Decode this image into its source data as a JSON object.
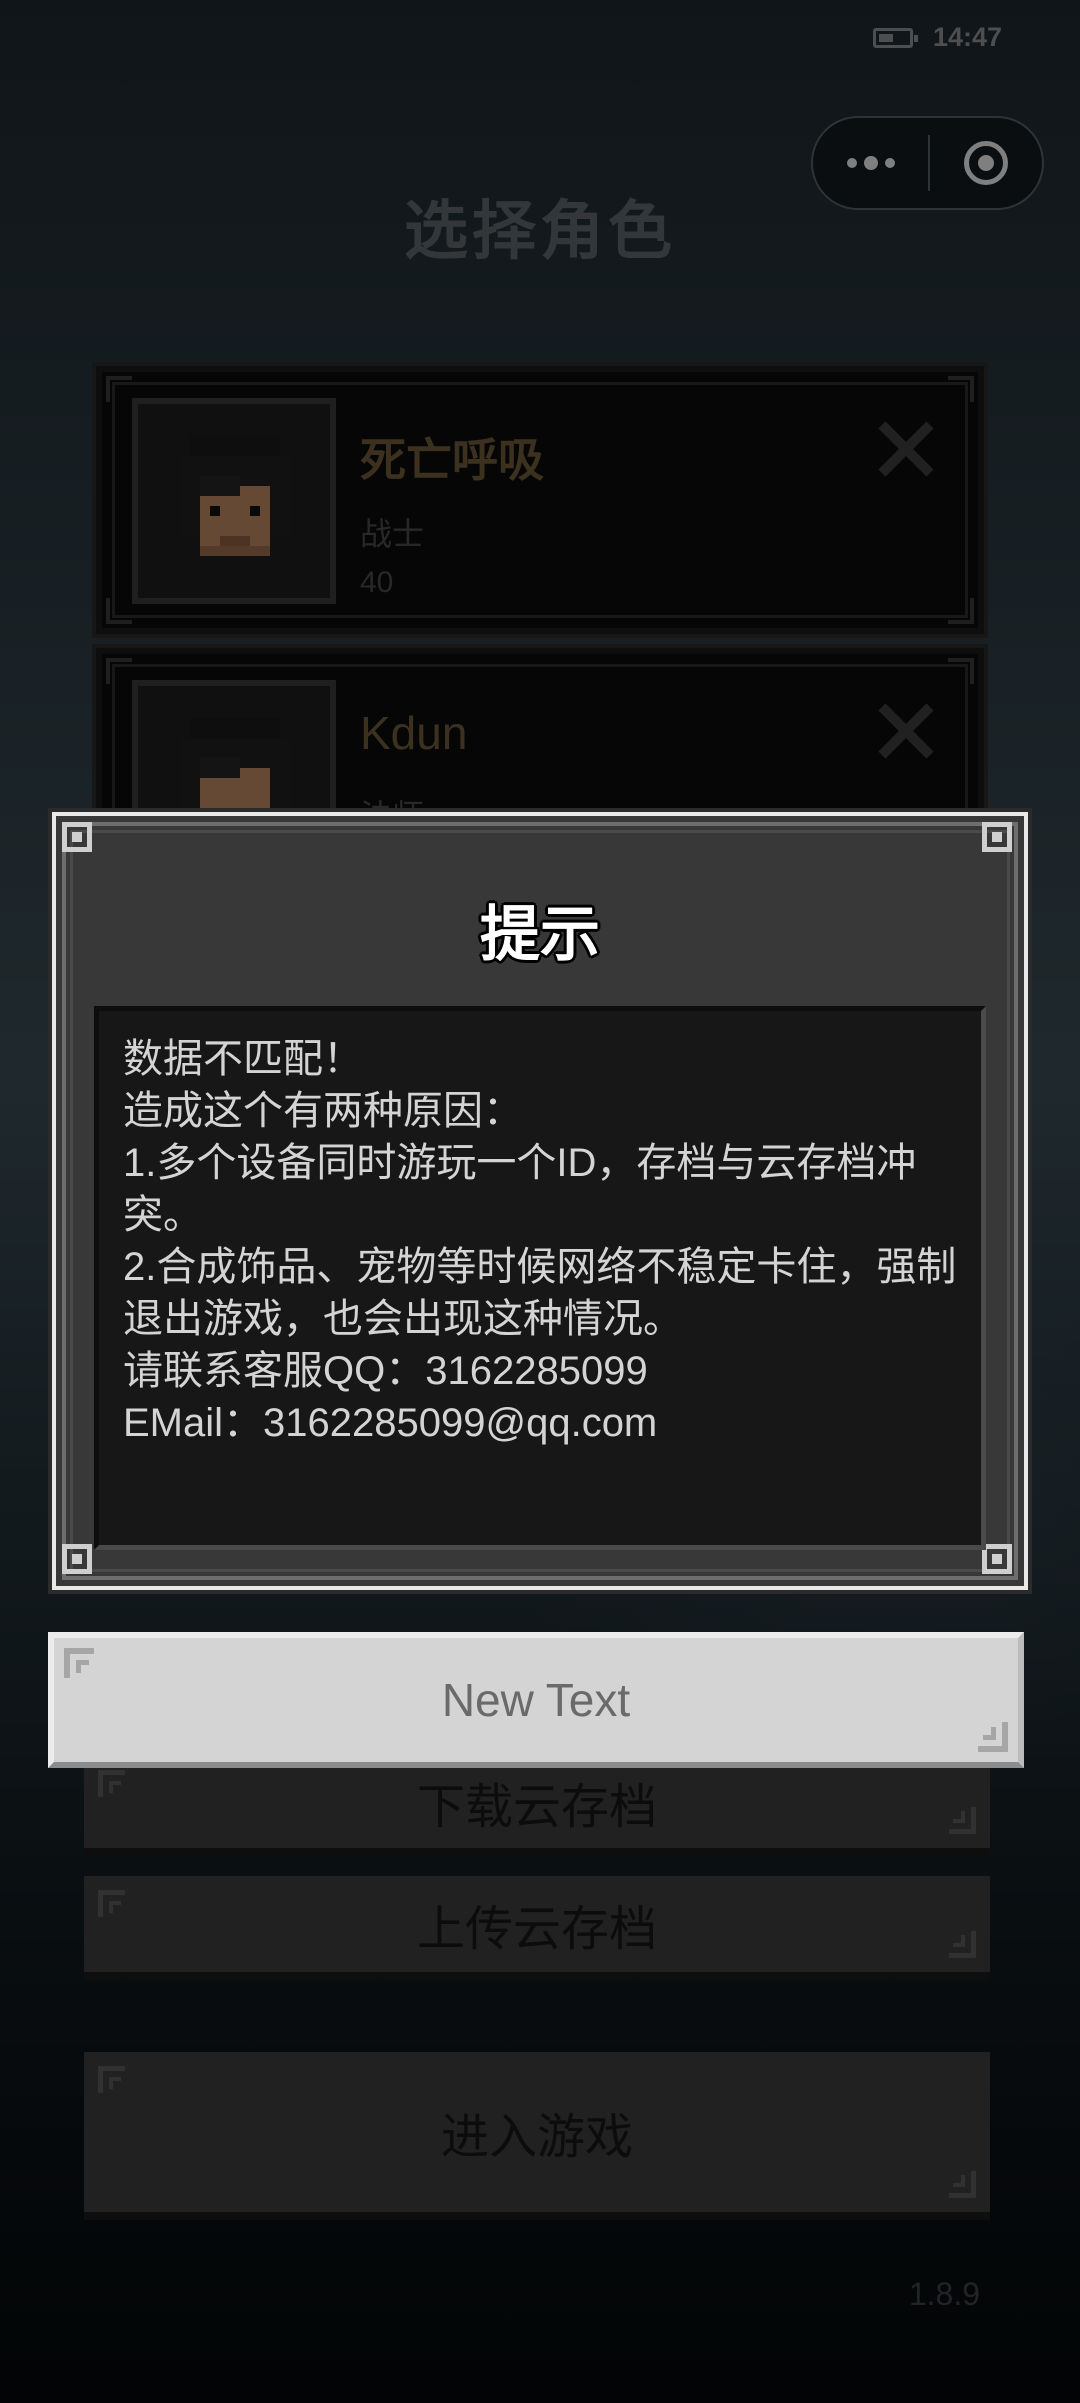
{
  "status_bar": {
    "time": "14:47",
    "battery_icon": "battery-icon"
  },
  "capsule": {
    "more_icon": "more-dots-icon",
    "close_icon": "target-circle-icon"
  },
  "page": {
    "title": "选择角色",
    "version": "1.8.9"
  },
  "characters": [
    {
      "name": "死亡呼吸",
      "class": "战士",
      "level": "40"
    },
    {
      "name": "Kdun",
      "class": "法师",
      "level": ""
    }
  ],
  "buttons": {
    "download": "下载云存档",
    "upload": "上传云存档",
    "enter": "进入游戏"
  },
  "dialog": {
    "title": "提示",
    "lines": [
      "数据不匹配！",
      "造成这个有两种原因：",
      "1.多个设备同时游玩一个ID，存档与云存档冲突。",
      "2.合成饰品、宠物等时候网络不稳定卡住，强制退出游戏，也会出现这种情况。",
      "请联系客服QQ：3162285099",
      "EMail：3162285099@qq.com"
    ],
    "button_label": "New Text"
  },
  "colors": {
    "name_gold": "#6e5a3a",
    "dialog_bg": "#383838",
    "message_bg": "#171717",
    "button_light": "#d4d4d4",
    "button_dark": "#3c3c3c"
  }
}
